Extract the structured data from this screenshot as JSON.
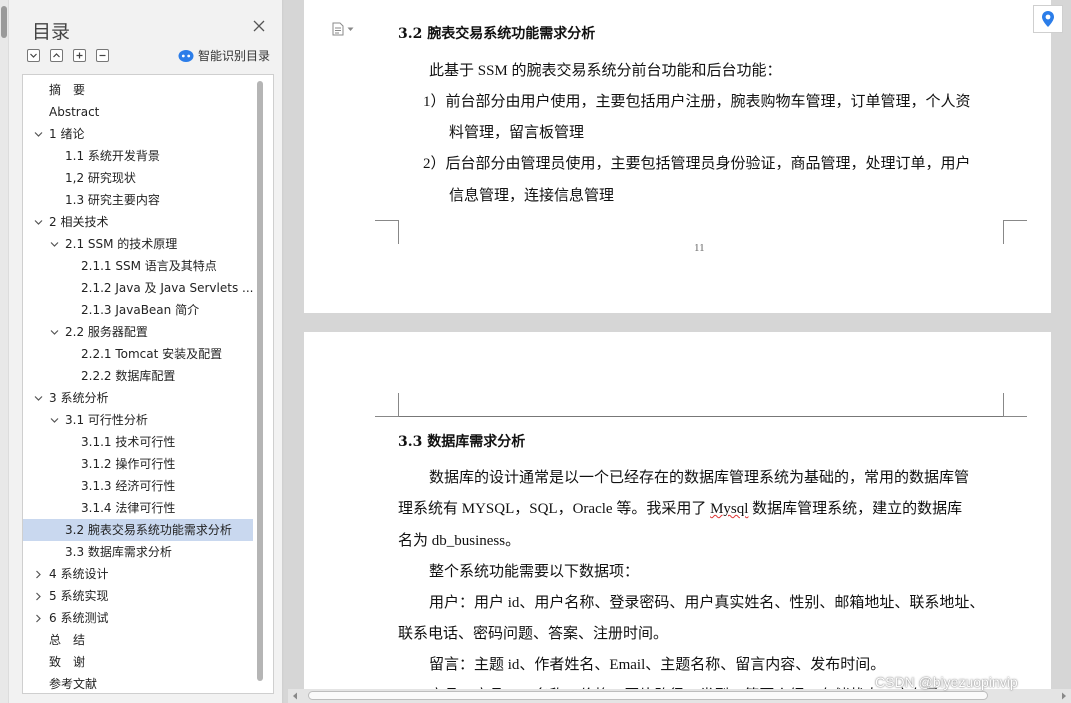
{
  "nav": {
    "title": "目录",
    "smart_toc_label": "智能识别目录",
    "tools": [
      "collapse-all",
      "expand-up",
      "add",
      "remove"
    ],
    "items": [
      {
        "text": "摘　要",
        "level": 1,
        "chevron": "none"
      },
      {
        "text": "Abstract",
        "level": 1,
        "chevron": "none"
      },
      {
        "text": "1 绪论",
        "level": 1,
        "chevron": "down"
      },
      {
        "text": "1.1 系统开发背景",
        "level": 2,
        "chevron": "none"
      },
      {
        "text": "1,2 研究现状",
        "level": 2,
        "chevron": "none"
      },
      {
        "text": "1.3 研究主要内容",
        "level": 2,
        "chevron": "none"
      },
      {
        "text": "2 相关技术",
        "level": 1,
        "chevron": "down"
      },
      {
        "text": "2.1 SSM 的技术原理",
        "level": 2,
        "chevron": "down"
      },
      {
        "text": "2.1.1 SSM 语言及其特点",
        "level": 3,
        "chevron": "none"
      },
      {
        "text": "2.1.2 Java 及 Java Servlets ...",
        "level": 3,
        "chevron": "none"
      },
      {
        "text": "2.1.3 JavaBean 简介",
        "level": 3,
        "chevron": "none"
      },
      {
        "text": "2.2  服务器配置",
        "level": 2,
        "chevron": "down"
      },
      {
        "text": "2.2.1 Tomcat 安装及配置",
        "level": 3,
        "chevron": "none"
      },
      {
        "text": "2.2.2  数据库配置",
        "level": 3,
        "chevron": "none"
      },
      {
        "text": "3 系统分析",
        "level": 1,
        "chevron": "down"
      },
      {
        "text": "3.1  可行性分析",
        "level": 2,
        "chevron": "down"
      },
      {
        "text": "3.1.1  技术可行性",
        "level": 3,
        "chevron": "none"
      },
      {
        "text": "3.1.2  操作可行性",
        "level": 3,
        "chevron": "none"
      },
      {
        "text": "3.1.3  经济可行性",
        "level": 3,
        "chevron": "none"
      },
      {
        "text": "3.1.4  法律可行性",
        "level": 3,
        "chevron": "none"
      },
      {
        "text": "3.2  腕表交易系统功能需求分析",
        "level": 2,
        "chevron": "none",
        "active": true
      },
      {
        "text": "3.3  数据库需求分析",
        "level": 2,
        "chevron": "none"
      },
      {
        "text": "4 系统设计",
        "level": 1,
        "chevron": "right"
      },
      {
        "text": "5 系统实现",
        "level": 1,
        "chevron": "right"
      },
      {
        "text": "6 系统测试",
        "level": 1,
        "chevron": "right"
      },
      {
        "text": "总　结",
        "level": 1,
        "chevron": "none"
      },
      {
        "text": "致　谢",
        "level": 1,
        "chevron": "none"
      },
      {
        "text": "参考文献",
        "level": 1,
        "chevron": "none"
      }
    ]
  },
  "page1": {
    "heading": "3.2  腕表交易系统功能需求分析",
    "intro": "此基于 SSM 的腕表交易系统分前台功能和后台功能：",
    "item1_line1": "1）前台部分由用户使用，主要包括用户注册，腕表购物车管理，订单管理，个人资",
    "item1_line2": "料管理，留言板管理",
    "item2_line1": "2）后台部分由管理员使用，主要包括管理员身份验证，商品管理，处理订单，用户",
    "item2_line2": "信息管理，连接信息管理",
    "page_number": "11"
  },
  "page2": {
    "heading": "3.3  数据库需求分析",
    "p1_line1": "数据库的设计通常是以一个已经存在的数据库管理系统为基础的，常用的数据库管",
    "p1_line2_a": "理系统有 MYSQL，SQL，Oracle 等。我采用了 ",
    "p1_line2_b": "Mysql",
    "p1_line2_c": " 数据库管理系统，建立的数据库",
    "p1_line3": "名为 db_business。",
    "p2": "整个系统功能需要以下数据项：",
    "p3_line1": "用户：用户 id、用户名称、登录密码、用户真实姓名、性别、邮箱地址、联系地址、",
    "p3_line2": "联系电话、密码问题、答案、注册时间。",
    "p4": "留言：主题 id、作者姓名、Email、主题名称、留言内容、发布时间。",
    "p5_partial": "商品：商品 id、名称、价格、图片路径、类型、简要介绍、存储状态、库存量"
  },
  "watermark": "CSDN @biyezuopinvip",
  "colors": {
    "active_item": "#c9d8ef",
    "pin_blue": "#2b7de9",
    "smart_icon_blue": "#2b7de9"
  }
}
